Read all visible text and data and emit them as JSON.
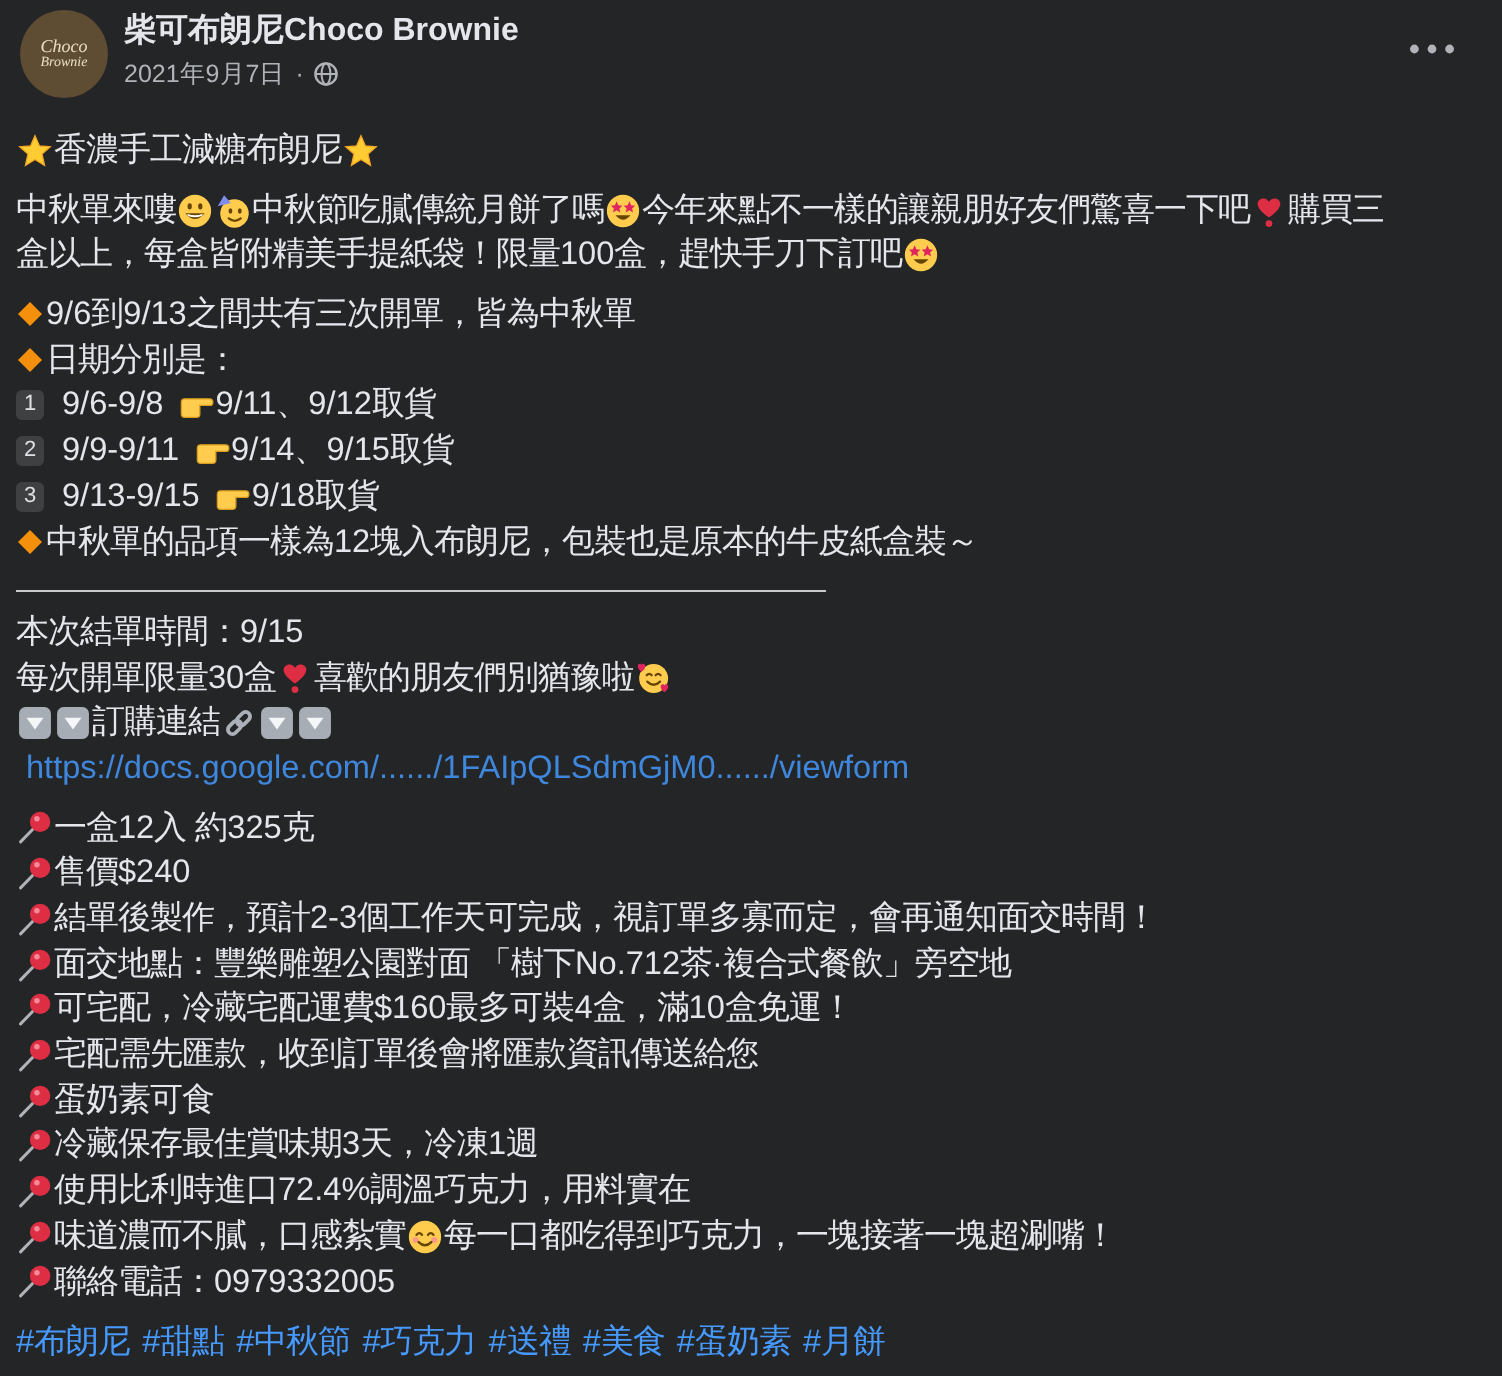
{
  "post": {
    "author": {
      "name": "柴可布朗尼Choco Brownie",
      "avatar_logo": [
        "Choco",
        "Brownie"
      ]
    },
    "date": "2021年9月7日",
    "date_separator": "·",
    "paragraphs": [
      {
        "lines": [
          [
            {
              "kind": "star"
            },
            {
              "kind": "text",
              "text": "香濃手工減糖布朗尼"
            },
            {
              "kind": "star"
            }
          ]
        ]
      },
      {
        "lines": [
          [
            {
              "kind": "text",
              "text": "中秋單來嘍"
            },
            {
              "kind": "grin"
            },
            {
              "kind": "party"
            },
            {
              "kind": "text",
              "text": "中秋節吃膩傳統月餅了嗎"
            },
            {
              "kind": "starstruck"
            },
            {
              "kind": "text",
              "text": "今年來點不一樣的讓親朋好友們驚喜一下吧"
            },
            {
              "kind": "heart"
            },
            {
              "kind": "text",
              "text": "購買三"
            }
          ],
          [
            {
              "kind": "text",
              "text": "盒以上，每盒皆附精美手提紙袋！限量100盒，趕快手刀下訂吧"
            },
            {
              "kind": "starstruck"
            }
          ]
        ]
      },
      {
        "lines": [
          [
            {
              "kind": "diamond"
            },
            {
              "kind": "text",
              "text": "9/6到9/13之間共有三次開單，皆為中秋單"
            }
          ],
          [
            {
              "kind": "diamond"
            },
            {
              "kind": "text",
              "text": "日期分別是："
            }
          ],
          [
            {
              "kind": "keycap",
              "text": "1"
            },
            {
              "kind": "text",
              "text": "9/6-9/8"
            },
            {
              "kind": "hand"
            },
            {
              "kind": "text",
              "text": "9/11、9/12取貨"
            }
          ],
          [
            {
              "kind": "keycap",
              "text": "2"
            },
            {
              "kind": "text",
              "text": "9/9-9/11"
            },
            {
              "kind": "hand"
            },
            {
              "kind": "text",
              "text": "9/14、9/15取貨"
            }
          ],
          [
            {
              "kind": "keycap",
              "text": "3"
            },
            {
              "kind": "text",
              "text": "9/13-9/15"
            },
            {
              "kind": "hand"
            },
            {
              "kind": "text",
              "text": "9/18取貨"
            }
          ],
          [
            {
              "kind": "diamond"
            },
            {
              "kind": "text",
              "text": "中秋單的品項一樣為12塊入布朗尼，包裝也是原本的牛皮紙盒裝～"
            }
          ],
          [
            {
              "kind": "rule"
            }
          ],
          [
            {
              "kind": "text",
              "text": "本次結單時間：9/15"
            }
          ],
          [
            {
              "kind": "text",
              "text": "每次開單限量30盒"
            },
            {
              "kind": "heart"
            },
            {
              "kind": "text",
              "text": "喜歡的朋友們別猶豫啦"
            },
            {
              "kind": "hearts"
            }
          ],
          [
            {
              "kind": "down"
            },
            {
              "kind": "down"
            },
            {
              "kind": "text",
              "text": "訂購連結"
            },
            {
              "kind": "chain"
            },
            {
              "kind": "down"
            },
            {
              "kind": "down"
            }
          ],
          [
            {
              "kind": "link",
              "text": "https://docs.google.com/....../1FAIpQLSdmGjM0....../viewform"
            }
          ]
        ]
      },
      {
        "lines": [
          [
            {
              "kind": "pin"
            },
            {
              "kind": "text",
              "text": "一盒12入 約325克"
            }
          ],
          [
            {
              "kind": "pin"
            },
            {
              "kind": "text",
              "text": "售價$240"
            }
          ],
          [
            {
              "kind": "pin"
            },
            {
              "kind": "text",
              "text": "結單後製作，預計2-3個工作天可完成，視訂單多寡而定，會再通知面交時間！"
            }
          ],
          [
            {
              "kind": "pin"
            },
            {
              "kind": "text",
              "text": "面交地點：豐樂雕塑公園對面 「樹下No.712茶·複合式餐飲」旁空地"
            }
          ],
          [
            {
              "kind": "pin"
            },
            {
              "kind": "text",
              "text": "可宅配，冷藏宅配運費$160最多可裝4盒，滿10盒免運！"
            }
          ],
          [
            {
              "kind": "pin"
            },
            {
              "kind": "text",
              "text": "宅配需先匯款，收到訂單後會將匯款資訊傳送給您"
            }
          ],
          [
            {
              "kind": "pin"
            },
            {
              "kind": "text",
              "text": "蛋奶素可食"
            }
          ],
          [
            {
              "kind": "pin"
            },
            {
              "kind": "text",
              "text": "冷藏保存最佳賞味期3天，冷凍1週"
            }
          ],
          [
            {
              "kind": "pin"
            },
            {
              "kind": "text",
              "text": "使用比利時進口72.4%調溫巧克力，用料實在"
            }
          ],
          [
            {
              "kind": "pin"
            },
            {
              "kind": "text",
              "text": "味道濃而不膩，口感紮實"
            },
            {
              "kind": "smile"
            },
            {
              "kind": "text",
              "text": "每一口都吃得到巧克力，一塊接著一塊超涮嘴！"
            }
          ],
          [
            {
              "kind": "pin"
            },
            {
              "kind": "text",
              "text": "聯絡電話：0979332005"
            }
          ]
        ]
      }
    ],
    "hashtags": [
      "#布朗尼",
      "#甜點",
      "#中秋節",
      "#巧克力",
      "#送禮",
      "#美食",
      "#蛋奶素",
      "#月餅"
    ]
  }
}
